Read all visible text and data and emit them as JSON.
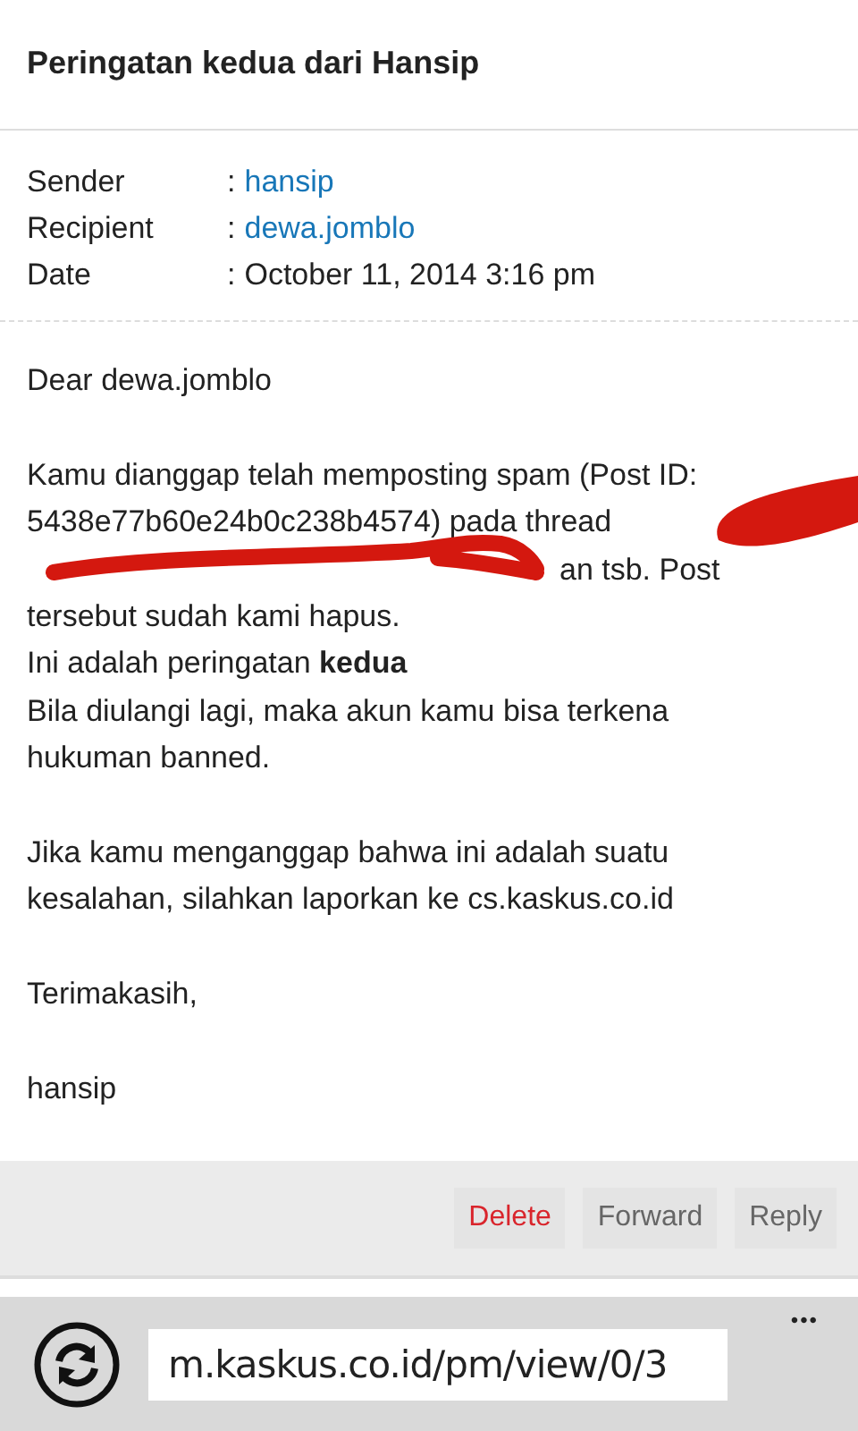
{
  "title": "Peringatan kedua dari Hansip",
  "meta": [
    {
      "label": "Sender",
      "sep": ":",
      "value": "hansip",
      "link": true
    },
    {
      "label": "Recipient",
      "sep": ":",
      "value": "dewa.jomblo",
      "link": true
    },
    {
      "label": "Date",
      "sep": ":",
      "value": "October 11, 2014 3:16 pm",
      "link": false
    }
  ],
  "body": [
    {
      "kind": "text",
      "text": "Dear dewa.jomblo"
    },
    {
      "kind": "gap"
    },
    {
      "kind": "text",
      "text": "Kamu dianggap telah memposting spam (Post ID:"
    },
    {
      "kind": "text",
      "text": "5438e77b60e24b0c238b4574) pada thread"
    },
    {
      "kind": "redacted",
      "text": "an tsb. Post"
    },
    {
      "kind": "text",
      "text": "tersebut sudah kami hapus."
    },
    {
      "kind": "text",
      "text": "Ini adalah peringatan **kedua**"
    },
    {
      "kind": "text",
      "text": "Bila diulangi lagi, maka akun kamu bisa terkena"
    },
    {
      "kind": "text",
      "text": "hukuman banned."
    },
    {
      "kind": "gap"
    },
    {
      "kind": "text",
      "text": "Jika kamu menganggap bahwa ini adalah suatu"
    },
    {
      "kind": "text",
      "text": "kesalahan, silahkan laporkan ke cs.kaskus.co.id"
    },
    {
      "kind": "gap"
    },
    {
      "kind": "text",
      "text": "Terimakasih,"
    },
    {
      "kind": "gap"
    },
    {
      "kind": "text",
      "text": "hansip"
    }
  ],
  "actions": [
    {
      "label": "Delete",
      "danger": true
    },
    {
      "label": "Forward",
      "danger": false
    },
    {
      "label": "Reply",
      "danger": false
    }
  ],
  "browser": {
    "url": "m.kaskus.co.id/pm/view/0/3",
    "more": "•••"
  }
}
